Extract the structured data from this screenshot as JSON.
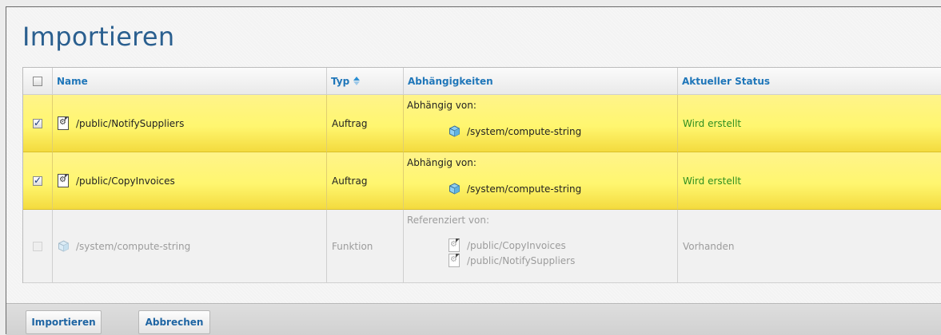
{
  "page": {
    "title": "Importieren"
  },
  "table": {
    "columns": {
      "name": "Name",
      "type": "Typ",
      "dependencies": "Abhängigkeiten",
      "status": "Aktueller Status"
    },
    "rows": [
      {
        "checked": true,
        "name": "/public/NotifySuppliers",
        "type": "Auftrag",
        "dep_label": "Abhängig von:",
        "deps": [
          "/system/compute-string"
        ],
        "status": "Wird erstellt"
      },
      {
        "checked": true,
        "name": "/public/CopyInvoices",
        "type": "Auftrag",
        "dep_label": "Abhängig von:",
        "deps": [
          "/system/compute-string"
        ],
        "status": "Wird erstellt"
      },
      {
        "checked": false,
        "disabled": true,
        "name": "/system/compute-string",
        "type": "Funktion",
        "dep_label": "Referenziert von:",
        "deps": [
          "/public/CopyInvoices",
          "/public/NotifySuppliers"
        ],
        "status": "Vorhanden"
      }
    ]
  },
  "footer": {
    "import_label": "Importieren",
    "cancel_label": "Abbrechen"
  },
  "colors": {
    "title": "#2a5f8f",
    "header_text": "#1f76b9",
    "selected_row": "#fff66f",
    "status_ok": "#2f8f20"
  },
  "icons": {
    "job": "mapping-file-icon",
    "function": "cube-icon",
    "sort": "sort-icon"
  }
}
